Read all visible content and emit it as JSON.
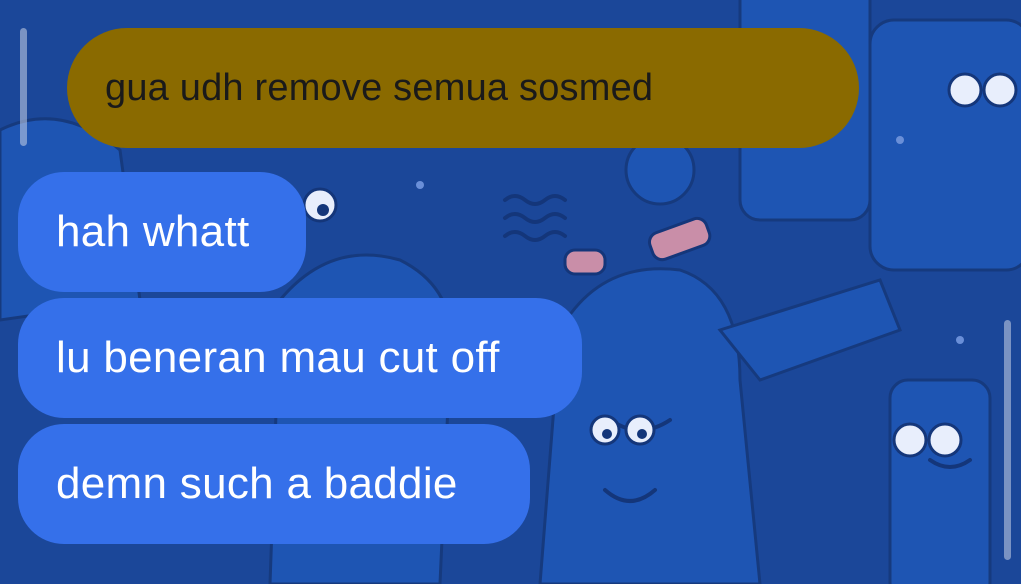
{
  "chat": {
    "messages": [
      {
        "text": "gua udh remove semua sosmed",
        "direction": "outgoing"
      },
      {
        "text": "hah whatt",
        "direction": "incoming"
      },
      {
        "text": "lu beneran mau cut off",
        "direction": "incoming"
      },
      {
        "text": "demn such a baddie",
        "direction": "incoming"
      }
    ]
  },
  "colors": {
    "wallpaper": "#1b4799",
    "outgoing_bubble": "#8a6a00",
    "incoming_bubble": "#3570ea",
    "outgoing_text": "#1a1a1a",
    "incoming_text": "#ffffff"
  }
}
